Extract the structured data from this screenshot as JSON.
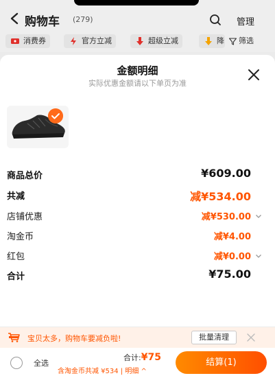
{
  "cart": {
    "title": "购物车",
    "count": "(279)",
    "manage_label": "管理"
  },
  "filters": {
    "chips": [
      "消费券",
      "官方立减",
      "超级立减",
      "降"
    ],
    "filter_label": "筛选"
  },
  "sheet": {
    "title": "金额明细",
    "subtitle": "实际优惠金额请以下单页为准",
    "rows": {
      "subtotal": {
        "label": "商品总价",
        "value": "¥609.00"
      },
      "discount": {
        "label": "共减",
        "value": "减¥534.00"
      },
      "store": {
        "label": "店铺优惠",
        "value": "减¥530.00"
      },
      "coins": {
        "label": "淘金币",
        "value": "减¥4.00"
      },
      "redpacket": {
        "label": "红包",
        "value": "减¥0.00"
      },
      "total": {
        "label": "合计",
        "value": "¥75.00"
      }
    }
  },
  "notice": {
    "text": "宝贝太多，购物车要减负啦!",
    "clear_label": "批量清理"
  },
  "checkout": {
    "select_all_label": "全选",
    "total_prefix": "合计:",
    "total_amount": "¥75",
    "sub_line": "含淘金币共减 ¥534 | 明细 ^",
    "button_label": "结算(1)"
  },
  "colors": {
    "accent": "#ff5500",
    "sheet_bg": "#ffffff",
    "page_bg": "#eeeeee"
  }
}
